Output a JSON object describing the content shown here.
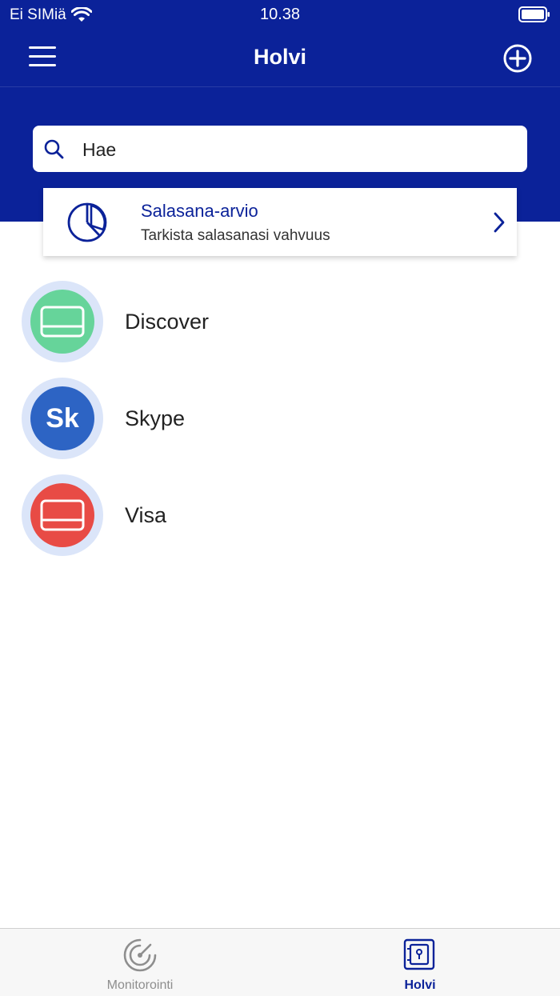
{
  "status": {
    "carrier": "Ei SIMiä",
    "time": "10.38"
  },
  "header": {
    "title": "Holvi",
    "menu_icon": "hamburger-menu-icon",
    "add_icon": "plus-circle-icon",
    "color": "#0b2299"
  },
  "search": {
    "placeholder": "Hae",
    "icon": "search-icon"
  },
  "password_check": {
    "title": "Salasana-arvio",
    "subtitle": "Tarkista salasanasi vahvuus",
    "icon": "pie-chart-icon"
  },
  "vault": {
    "items": [
      {
        "label": "Discover",
        "icon": "credit-card-icon",
        "color": "#66d49a"
      },
      {
        "label": "Skype",
        "initials": "Sk",
        "color": "#2d64c4"
      },
      {
        "label": "Visa",
        "icon": "credit-card-icon",
        "color": "#e84b45"
      }
    ]
  },
  "tabs": [
    {
      "label": "Monitorointi",
      "icon": "radar-icon",
      "active": false,
      "color": "#8e8e8e"
    },
    {
      "label": "Holvi",
      "icon": "vault-icon",
      "active": true,
      "color": "#0b2299"
    }
  ]
}
